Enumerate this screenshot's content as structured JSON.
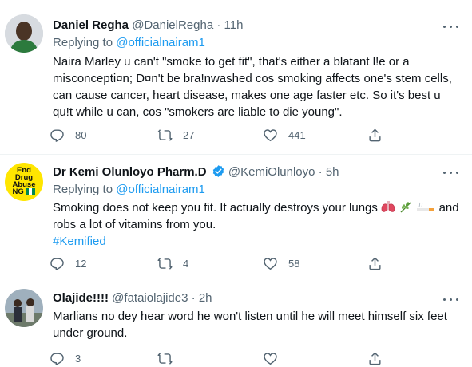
{
  "tweets": [
    {
      "author": "Daniel Regha",
      "handle": "@DanielRegha",
      "time": "11h",
      "replying_prefix": "Replying to",
      "replying_to": "@officialnairam1",
      "text": "Naira Marley u can't \"smoke to get fit\", that's either a blatant l!e or a misconcepti¤n; D¤n't be bra!nwashed cos smoking affects one's stem cells, can cause cancer, heart disease, makes one age faster etc. So it's best u qu!t while u can, cos \"smokers are liable to die young\".",
      "counts": {
        "replies": "80",
        "retweets": "27",
        "likes": "441"
      }
    },
    {
      "author": "Dr Kemi Olunloyo Pharm.D",
      "handle": "@KemiOlunloyo",
      "time": "5h",
      "replying_prefix": "Replying to",
      "replying_to": "@officialnairam1",
      "text_main": "Smoking does not keep you fit. It actually destroys your lungs",
      "text_tail": "and robs a lot of vitamins from you.",
      "hashtag": "#Kemified",
      "avatar_text": [
        "End",
        "Drug",
        "Abuse",
        "NG"
      ],
      "counts": {
        "replies": "12",
        "retweets": "4",
        "likes": "58"
      }
    },
    {
      "author": "Olajide!!!!",
      "handle": "@fataiolajide3",
      "time": "2h",
      "text": "Marlians no dey hear word he won't listen until he will meet himself six feet under ground.",
      "counts": {
        "replies": "3"
      }
    }
  ],
  "separator": "·",
  "icons": [
    "reply-icon",
    "retweet-icon",
    "like-icon",
    "share-icon",
    "more-icon",
    "verified-icon"
  ],
  "colors": {
    "link": "#1d9bf0",
    "muted": "#536471",
    "text": "#0f1419",
    "border": "#eff3f4"
  }
}
